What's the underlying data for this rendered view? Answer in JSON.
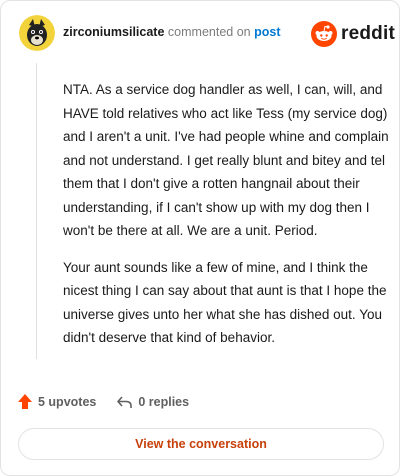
{
  "header": {
    "username": "zirconiumsilicate",
    "action_text": "commented on",
    "post_link": "post",
    "brand": "reddit"
  },
  "comment": {
    "paragraphs": [
      "NTA. As a service dog handler as well, I can, will, and HAVE told relatives who act like Tess (my service dog) and I aren't a unit. I've had people whine and complain and not understand. I get really blunt and bitey and tel them that I don't give a rotten hangnail about their understanding, if I can't show up with my dog then I won't be there at all. We are a unit. Period.",
      "Your aunt sounds like a few of mine, and I think the nicest thing I can say about that aunt is that I hope the universe gives unto her what she has dished out. You didn't deserve that kind of behavior."
    ]
  },
  "footer": {
    "upvotes_label": "5 upvotes",
    "replies_label": "0 replies",
    "view_label": "View the conversation"
  },
  "icons": {
    "upvote": "upvote-arrow-icon",
    "reply": "reply-arrow-icon",
    "logo": "reddit-snoo-icon",
    "avatar": "dog-avatar"
  },
  "colors": {
    "link": "#0079d3",
    "upvote": "#ff4500",
    "view_button_text": "#c7400a",
    "muted": "#7c7c7c"
  }
}
